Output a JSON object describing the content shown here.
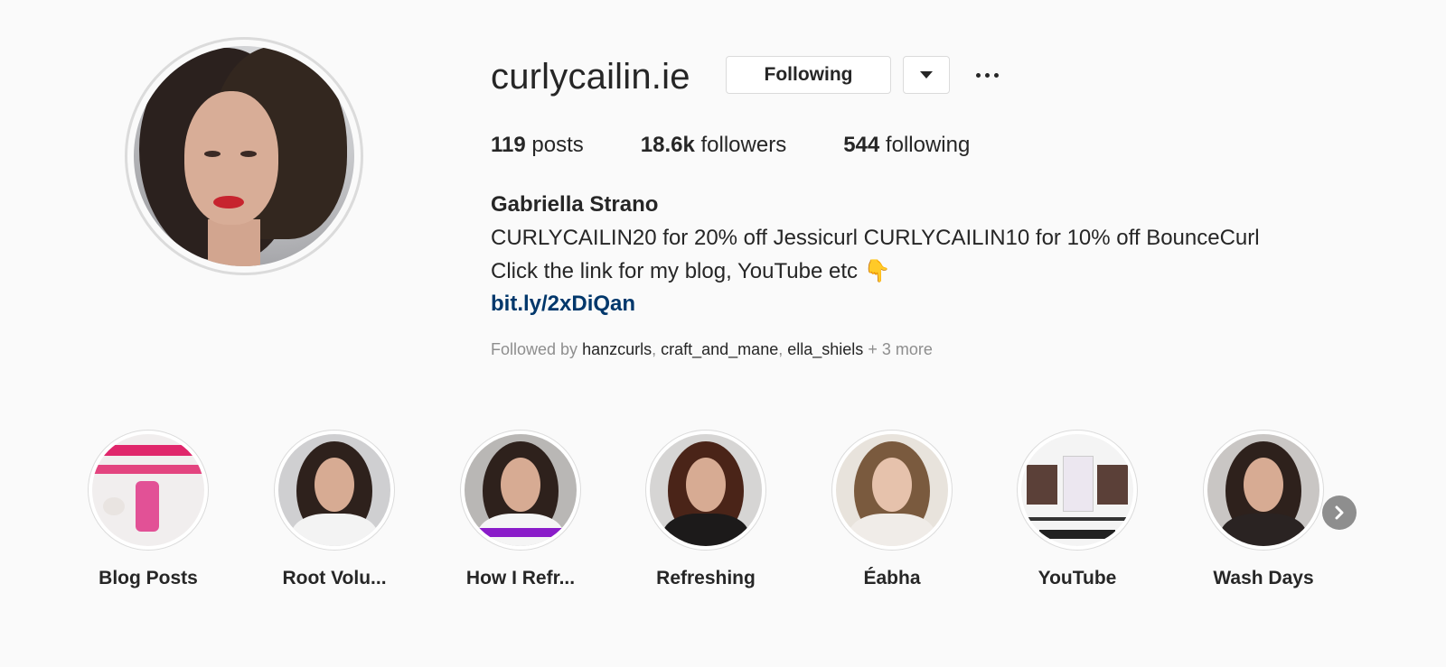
{
  "profile": {
    "username": "curlycailin.ie",
    "following_button": "Following",
    "stats": {
      "posts_count": "119",
      "posts_label": "posts",
      "followers_count": "18.6k",
      "followers_label": "followers",
      "following_count": "544",
      "following_label": "following"
    },
    "full_name": "Gabriella Strano",
    "bio_line1": "CURLYCAILIN20 for 20% off Jessicurl CURLYCAILIN10 for 10% off BounceCurl",
    "bio_line2": "Click the link for my blog, YouTube etc 👇",
    "link": "bit.ly/2xDiQan",
    "followed_by": {
      "prefix": "Followed by",
      "users": [
        "hanzcurls",
        "craft_and_mane",
        "ella_shiels"
      ],
      "more": "+ 3 more"
    }
  },
  "highlights": [
    {
      "label": "Blog Posts"
    },
    {
      "label": "Root Volu..."
    },
    {
      "label": "How I Refr..."
    },
    {
      "label": "Refreshing"
    },
    {
      "label": "Éabha"
    },
    {
      "label": "YouTube"
    },
    {
      "label": "Wash Days"
    }
  ],
  "icons": {
    "dropdown": "caret-down-icon",
    "more": "more-options-icon",
    "next": "chevron-right-icon"
  },
  "colors": {
    "background": "#fafafa",
    "text": "#262626",
    "secondary_text": "#8e8e8e",
    "link": "#00376b",
    "border": "#dbdbdb"
  }
}
